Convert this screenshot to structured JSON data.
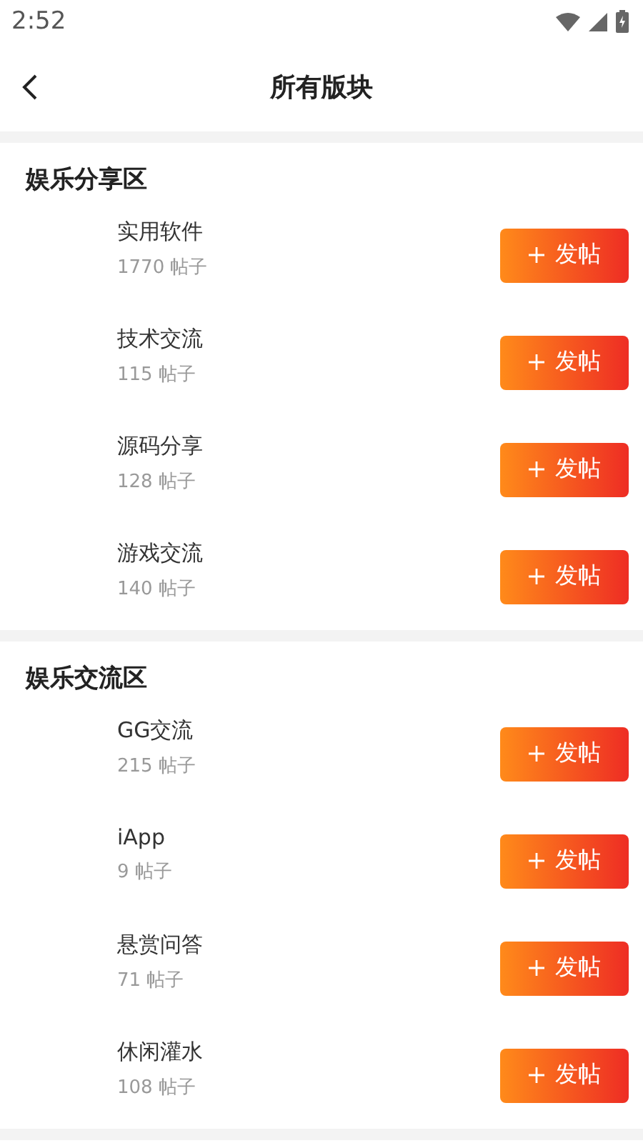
{
  "status_bar": {
    "time": "2:52"
  },
  "header": {
    "title": "所有版块"
  },
  "sections": [
    {
      "title": "娱乐分享区",
      "boards": [
        {
          "name": "实用软件",
          "count": "1770 帖子",
          "button": "发帖"
        },
        {
          "name": "技术交流",
          "count": "115 帖子",
          "button": "发帖"
        },
        {
          "name": "源码分享",
          "count": "128 帖子",
          "button": "发帖"
        },
        {
          "name": "游戏交流",
          "count": "140 帖子",
          "button": "发帖"
        }
      ]
    },
    {
      "title": "娱乐交流区",
      "boards": [
        {
          "name": "GG交流",
          "count": "215 帖子",
          "button": "发帖"
        },
        {
          "name": "iApp",
          "count": "9 帖子",
          "button": "发帖"
        },
        {
          "name": "悬赏问答",
          "count": "71 帖子",
          "button": "发帖"
        },
        {
          "name": "休闲灌水",
          "count": "108 帖子",
          "button": "发帖"
        }
      ]
    }
  ]
}
